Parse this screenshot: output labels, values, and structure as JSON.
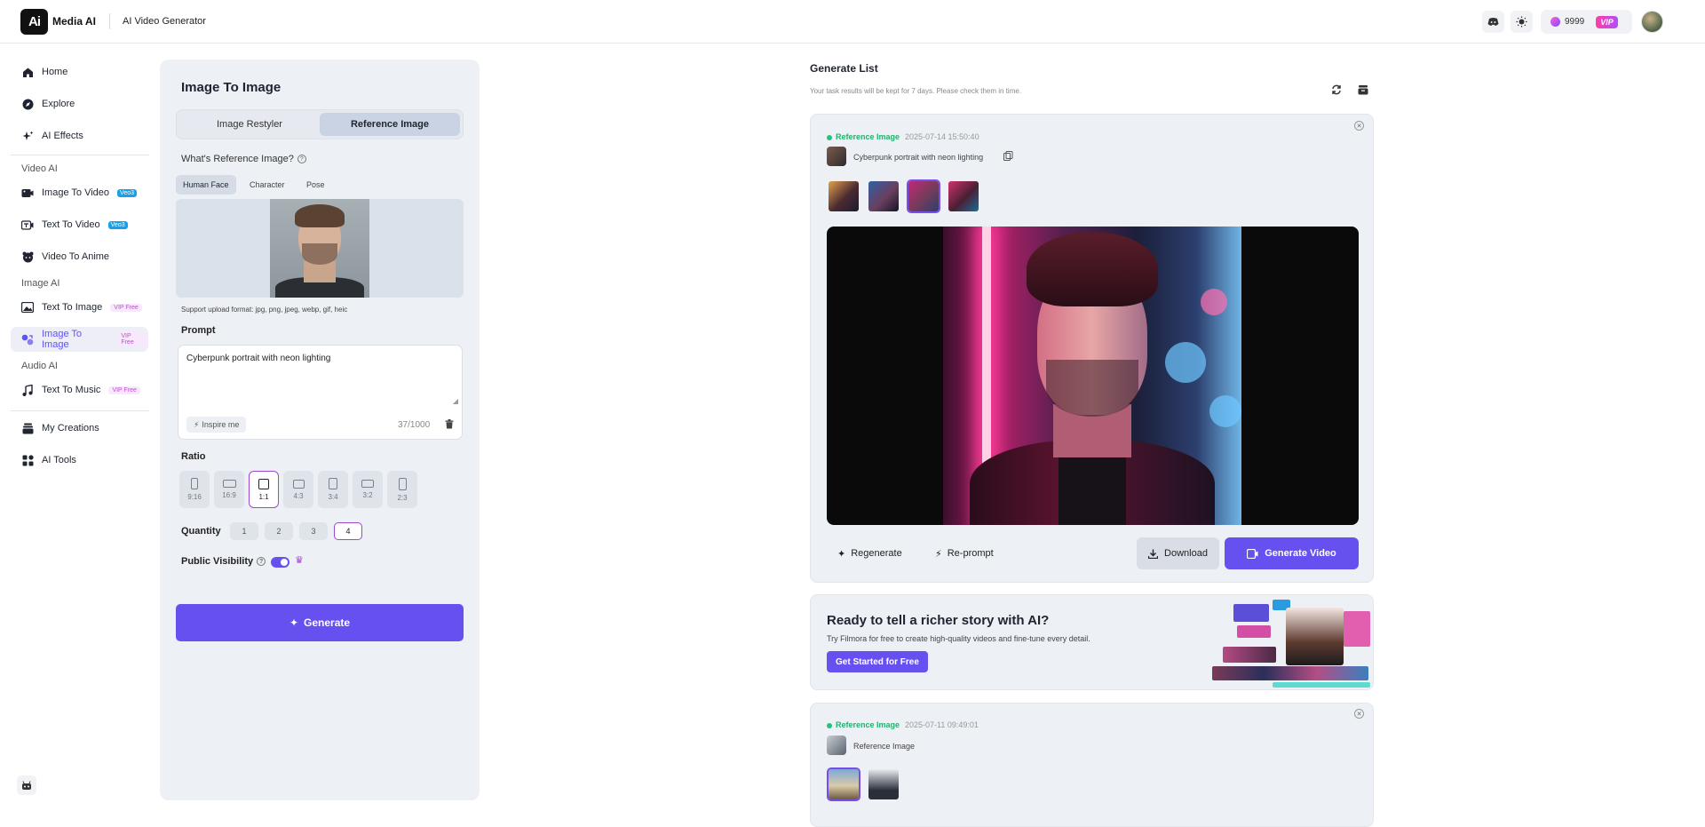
{
  "header": {
    "logo_mark": "Ai",
    "brand": "Media AI",
    "page_title": "AI Video Generator",
    "credits": "9999",
    "vip": "VIP"
  },
  "sidebar": {
    "items": [
      {
        "label": "Home",
        "icon": "home-icon"
      },
      {
        "label": "Explore",
        "icon": "compass-icon"
      },
      {
        "label": "AI Effects",
        "icon": "sparkles-icon"
      }
    ],
    "sections": {
      "video": "Video AI",
      "image": "Image AI",
      "audio": "Audio AI"
    },
    "video_items": [
      {
        "label": "Image To Video",
        "badge": "Veo3"
      },
      {
        "label": "Text To Video",
        "badge": "Veo3"
      },
      {
        "label": "Video To Anime",
        "badge": ""
      }
    ],
    "image_items": [
      {
        "label": "Text To Image",
        "badge": "VIP Free"
      },
      {
        "label": "Image To Image",
        "badge": "VIP Free"
      }
    ],
    "audio_items": [
      {
        "label": "Text To Music",
        "badge": "VIP Free"
      }
    ],
    "bottom_items": [
      {
        "label": "My Creations"
      },
      {
        "label": "AI Tools"
      }
    ]
  },
  "panel": {
    "title": "Image To Image",
    "modes": [
      "Image Restyler",
      "Reference Image"
    ],
    "active_mode": "Reference Image",
    "reference_question": "What's Reference Image?",
    "reference_tabs": [
      "Human Face",
      "Character",
      "Pose"
    ],
    "active_reference_tab": "Human Face",
    "upload_formats": "Support upload format: jpg, png, jpeg, webp, gif, heic",
    "prompt_label": "Prompt",
    "prompt_value": "Cyberpunk portrait with neon lighting",
    "inspire_label": "Inspire me",
    "char_count": "37/1000",
    "ratio_label": "Ratio",
    "ratios": [
      "9:16",
      "16:9",
      "1:1",
      "4:3",
      "3:4",
      "3:2",
      "2:3"
    ],
    "selected_ratio": "1:1",
    "quantity_label": "Quantity",
    "quantities": [
      "1",
      "2",
      "3",
      "4"
    ],
    "selected_quantity": "4",
    "visibility_label": "Public Visibility",
    "visibility_on": true,
    "generate_label": "Generate"
  },
  "generate_list": {
    "title": "Generate List",
    "notice": "Your task results will be kept for 7 days. Please check them in time.",
    "tasks": [
      {
        "type": "Reference Image",
        "timestamp": "2025-07-14 15:50:40",
        "caption": "Cyberpunk portrait with neon lighting",
        "variant_count": 4,
        "selected_variant": 3,
        "actions": {
          "regenerate": "Regenerate",
          "reprompt": "Re-prompt",
          "download": "Download",
          "generate_video": "Generate Video"
        }
      },
      {
        "type": "Reference Image",
        "timestamp": "2025-07-11 09:49:01",
        "caption": "Reference Image",
        "variant_count": 2,
        "selected_variant": 1
      }
    ]
  },
  "promo": {
    "heading": "Ready to tell a richer story with AI?",
    "text": "Try Filmora for free to create high-quality videos and fine-tune every detail.",
    "button": "Get Started for Free"
  },
  "colors": {
    "accent": "#6750f0",
    "panel_bg": "#edf0f5",
    "status_green": "#24c27a",
    "vip_pink": "#c24ed8"
  }
}
